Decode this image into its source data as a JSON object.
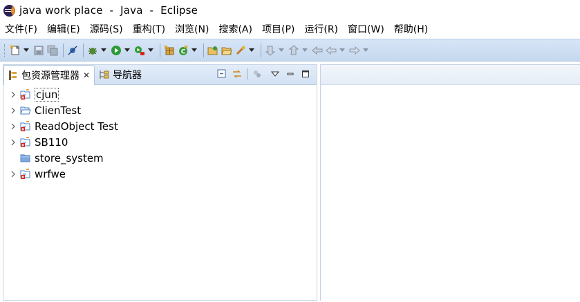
{
  "window": {
    "title": "java work place  -  Java  -  Eclipse",
    "app_icon": "eclipse-logo-icon"
  },
  "menu": [
    {
      "label": "文件(F)"
    },
    {
      "label": "编辑(E)"
    },
    {
      "label": "源码(S)"
    },
    {
      "label": "重构(T)"
    },
    {
      "label": "浏览(N)"
    },
    {
      "label": "搜索(A)"
    },
    {
      "label": "项目(P)"
    },
    {
      "label": "运行(R)"
    },
    {
      "label": "窗口(W)"
    },
    {
      "label": "帮助(H)"
    }
  ],
  "toolbar": {
    "icons": [
      "new-icon",
      "save-icon",
      "save-all-icon",
      "skip-breakpoints-icon",
      "debug-icon",
      "run-icon",
      "external-tools-icon",
      "new-java-package-icon",
      "new-java-class-icon",
      "open-type-icon",
      "open-folder-icon",
      "search-icon",
      "next-annotation-icon",
      "previous-annotation-icon",
      "last-edit-location-icon",
      "back-icon",
      "forward-icon"
    ]
  },
  "explorer": {
    "tabs": [
      {
        "label": "包资源管理器",
        "active": true,
        "close": "✕"
      },
      {
        "label": "导航器",
        "active": false
      }
    ],
    "items": [
      {
        "label": "cjun",
        "expandable": true,
        "icon": "java-project-error-icon",
        "selected": true
      },
      {
        "label": "ClienTest",
        "expandable": true,
        "icon": "folder-open-icon",
        "selected": false
      },
      {
        "label": "ReadObject Test",
        "expandable": true,
        "icon": "java-project-error-icon",
        "selected": false
      },
      {
        "label": "SB110",
        "expandable": true,
        "icon": "java-project-error-icon",
        "selected": false
      },
      {
        "label": "store_system",
        "expandable": false,
        "icon": "closed-project-icon",
        "selected": false
      },
      {
        "label": "wrfwe",
        "expandable": true,
        "icon": "java-project-error-icon",
        "selected": false
      }
    ]
  },
  "colors": {
    "toolbar_bg": "#c5d8ef",
    "tab_bg": "#d2e1f3",
    "error_red": "#d9261c",
    "folder_blue": "#6f9fd8"
  }
}
